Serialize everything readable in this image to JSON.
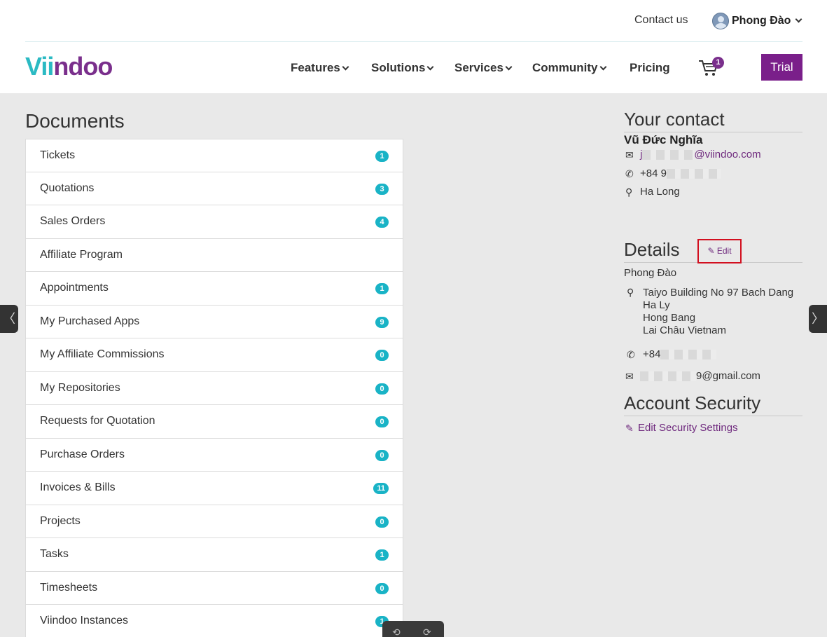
{
  "header": {
    "contact_link": "Contact us",
    "user_name": "Phong Đào"
  },
  "nav": {
    "logo": {
      "part1": "Vii",
      "part2": "ndoo"
    },
    "items": [
      "Features",
      "Solutions",
      "Services",
      "Community",
      "Pricing"
    ],
    "cart_count": "1",
    "trial_label": "Trial"
  },
  "documents": {
    "title": "Documents",
    "items": [
      {
        "label": "Tickets",
        "count": "1"
      },
      {
        "label": "Quotations",
        "count": "3"
      },
      {
        "label": "Sales Orders",
        "count": "4"
      },
      {
        "label": "Affiliate Program",
        "count": ""
      },
      {
        "label": "Appointments",
        "count": "1"
      },
      {
        "label": "My Purchased Apps",
        "count": "9"
      },
      {
        "label": "My Affiliate Commissions",
        "count": "0"
      },
      {
        "label": "My Repositories",
        "count": "0"
      },
      {
        "label": "Requests for Quotation",
        "count": "0"
      },
      {
        "label": "Purchase Orders",
        "count": "0"
      },
      {
        "label": "Invoices & Bills",
        "count": "11"
      },
      {
        "label": "Projects",
        "count": "0"
      },
      {
        "label": "Tasks",
        "count": "1"
      },
      {
        "label": "Timesheets",
        "count": "0"
      },
      {
        "label": "Viindoo Instances",
        "count": "1"
      }
    ]
  },
  "your_contact": {
    "title": "Your contact",
    "name": "Vũ Đức Nghĩa",
    "email_prefix": "j",
    "email_suffix": "@viindoo.com",
    "phone_prefix": "+84 9",
    "city": "Ha Long"
  },
  "details": {
    "title": "Details",
    "edit_label": "Edit",
    "name": "Phong Đào",
    "address": [
      "Taiyo Building No 97 Bach Dang",
      "Ha Ly",
      "Hong Bang",
      "Lai Châu Vietnam"
    ],
    "phone_prefix": "+84",
    "email_suffix": "9@gmail.com"
  },
  "account_security": {
    "title": "Account Security",
    "link_label": "Edit Security Settings"
  }
}
